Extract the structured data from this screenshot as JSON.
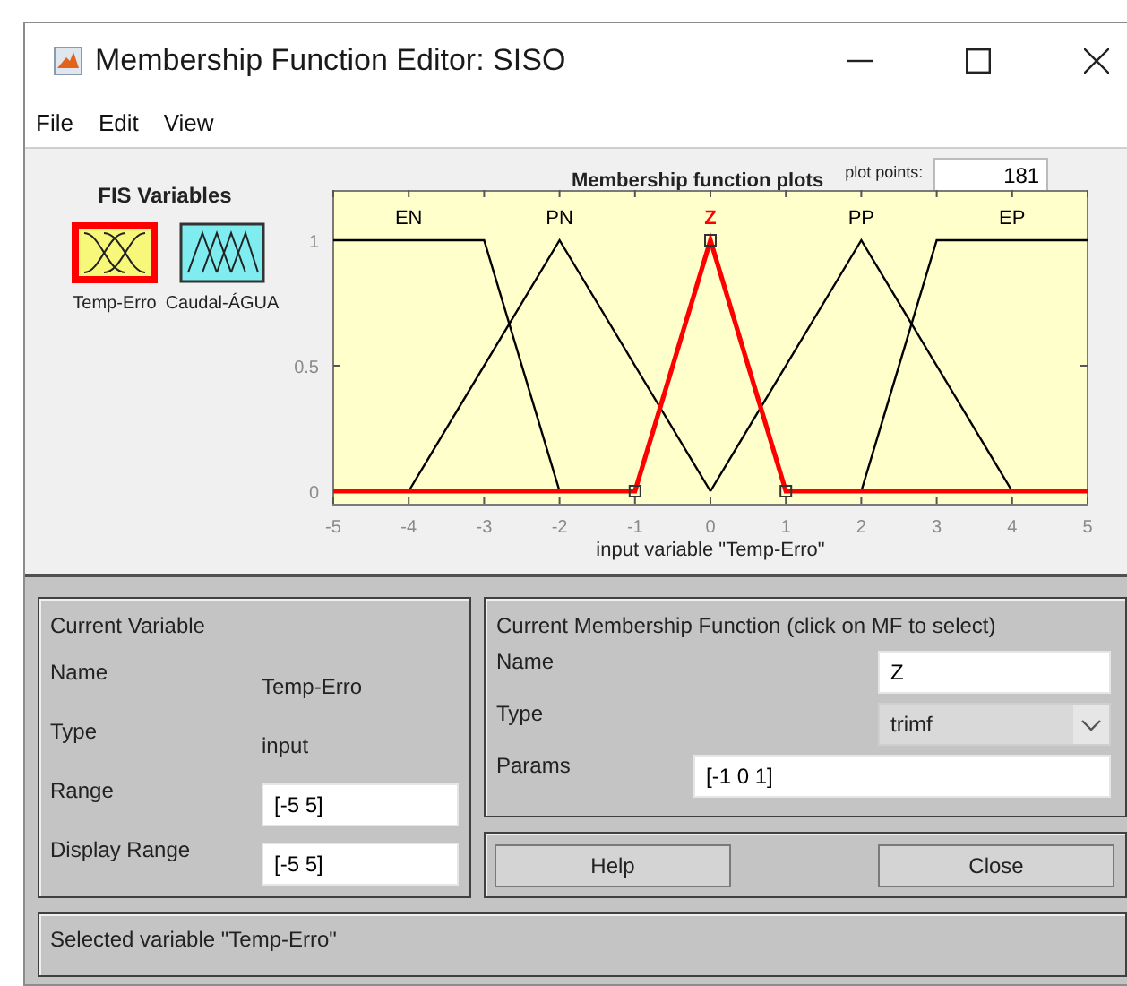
{
  "window": {
    "title": "Membership Function Editor: SISO"
  },
  "menu": [
    "File",
    "Edit",
    "View"
  ],
  "fis_variables": {
    "title": "FIS Variables",
    "items": [
      {
        "name": "Temp-Erro",
        "kind": "input",
        "selected": true
      },
      {
        "name": "Caudal-ÁGUA",
        "kind": "output",
        "selected": false
      }
    ]
  },
  "plot_points": {
    "label": "plot points:",
    "value": "181"
  },
  "chart_data": {
    "type": "line",
    "title": "Membership function plots",
    "xlabel": "input variable \"Temp-Erro\"",
    "xlim": [
      -5,
      5
    ],
    "ylim": [
      -0.05,
      1.2
    ],
    "xticks": [
      -5,
      -4,
      -3,
      -2,
      -1,
      0,
      1,
      2,
      3,
      4,
      5
    ],
    "yticks": [
      0,
      0.5,
      1
    ],
    "series": [
      {
        "name": "EN",
        "color": "#000000",
        "x": [
          -5,
          -3,
          -2
        ],
        "values": [
          1,
          1,
          0
        ]
      },
      {
        "name": "PN",
        "color": "#000000",
        "x": [
          -4,
          -2,
          0
        ],
        "values": [
          0,
          1,
          0
        ]
      },
      {
        "name": "PP",
        "color": "#000000",
        "x": [
          0,
          2,
          4
        ],
        "values": [
          0,
          1,
          0
        ]
      },
      {
        "name": "EP",
        "color": "#000000",
        "x": [
          2,
          3,
          5
        ],
        "values": [
          0,
          1,
          1
        ]
      },
      {
        "name": "Z",
        "color": "#ff0000",
        "x": [
          -5,
          -1,
          0,
          1,
          5
        ],
        "values": [
          0,
          0,
          1,
          0,
          0
        ]
      }
    ]
  },
  "current_variable": {
    "title": "Current Variable",
    "fields": [
      {
        "label": "Name",
        "value": "Temp-Erro",
        "kind": "text"
      },
      {
        "label": "Type",
        "value": "input",
        "kind": "text"
      },
      {
        "label": "Range",
        "value": "[-5 5]",
        "kind": "input"
      },
      {
        "label": "Display Range",
        "value": "[-5 5]",
        "kind": "input"
      }
    ]
  },
  "current_mf": {
    "title": "Current Membership Function (click on MF to select)",
    "fields": [
      {
        "label": "Name",
        "value": "Z",
        "kind": "input"
      },
      {
        "label": "Type",
        "value": "trimf",
        "kind": "dropdown"
      },
      {
        "label": "Params",
        "value": "[-1 0 1]",
        "kind": "wide_input"
      }
    ]
  },
  "buttons": [
    "Help",
    "Close"
  ],
  "status": "Selected variable \"Temp-Erro\""
}
